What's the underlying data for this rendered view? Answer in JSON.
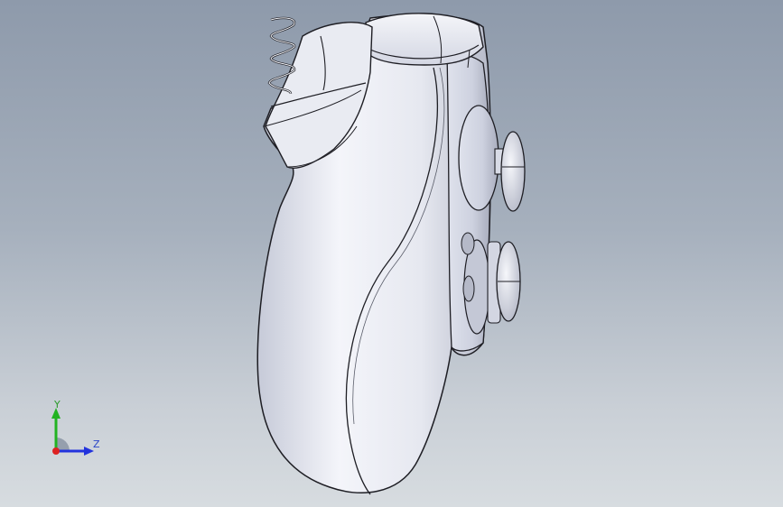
{
  "viewport": {
    "background_top": "#8e9aab",
    "background_bottom": "#d7dce0"
  },
  "model": {
    "description_icon": "game-controller-model",
    "body_color": "#eef0f6",
    "edge_color": "#1e1e24",
    "shade_color": "#b9bdcb"
  },
  "triad": {
    "y_label": "Y",
    "z_label": "Z",
    "y_color": "#22b322",
    "z_color": "#2233dd",
    "x_color": "#dd2222"
  }
}
